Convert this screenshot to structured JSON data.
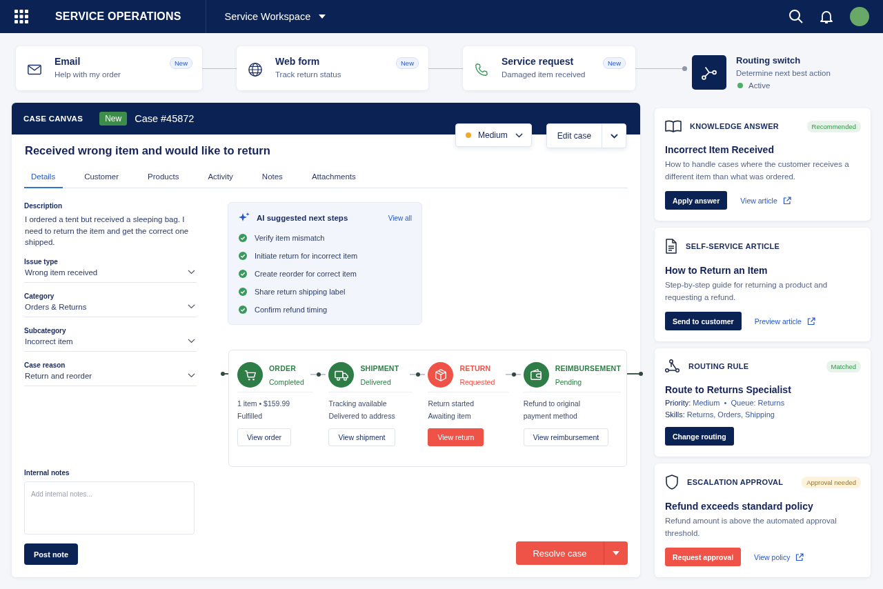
{
  "header": {
    "title": "SERVICE OPERATIONS",
    "workspace": "Service Workspace"
  },
  "channels": [
    {
      "title": "Email",
      "subtitle": "Help with my order",
      "badge": "New"
    },
    {
      "title": "Web form",
      "subtitle": "Track return status",
      "badge": "New"
    },
    {
      "title": "Service request",
      "subtitle": "Damaged item received",
      "badge": "New"
    }
  ],
  "routing_switch": {
    "title": "Routing switch",
    "subtitle": "Determine next best action",
    "status": "Active",
    "color": "#4caf6a"
  },
  "case": {
    "label": "CASE CANVAS",
    "badge": "New",
    "number": "Case #45872",
    "title": "Received wrong item and would like to return",
    "priority": {
      "value": "Medium",
      "color": "#f0a830"
    },
    "edit_button": "Edit case",
    "tabs": [
      {
        "label": "Details",
        "selected": true
      },
      {
        "label": "Customer",
        "selected": false
      },
      {
        "label": "Products",
        "selected": false
      },
      {
        "label": "Activity",
        "selected": false
      },
      {
        "label": "Notes",
        "selected": false
      },
      {
        "label": "Attachments",
        "selected": false
      }
    ],
    "description_label": "Description",
    "description": "I ordered a tent but received a sleeping bag. I need to return the item and get the correct one shipped.",
    "fields": [
      {
        "label": "Issue type",
        "value": "Wrong item received"
      },
      {
        "label": "Category",
        "value": "Orders & Returns"
      },
      {
        "label": "Subcategory",
        "value": "Incorrect item"
      },
      {
        "label": "Case reason",
        "value": "Return and reorder"
      }
    ],
    "notes_label": "Internal notes",
    "notes_placeholder": "Add internal notes...",
    "post_button": "Post note",
    "ai": {
      "title": "AI suggested next steps",
      "link": "View all",
      "steps": [
        {
          "text": "Verify item mismatch",
          "done": true
        },
        {
          "text": "Initiate return for incorrect item",
          "done": true
        },
        {
          "text": "Create reorder for correct item",
          "done": true
        },
        {
          "text": "Share return shipping label",
          "done": true
        },
        {
          "text": "Confirm refund timing",
          "done": true
        }
      ]
    },
    "stages": [
      {
        "title": "ORDER",
        "status": "Completed",
        "color": "#2e7d46",
        "details": [
          "1 item  •  $159.99",
          "Fulfilled"
        ],
        "button": "View order",
        "primary": false
      },
      {
        "title": "SHIPMENT",
        "status": "Delivered",
        "color": "#2e7d46",
        "details": [
          "Tracking available",
          "Delivered to address"
        ],
        "button": "View shipment",
        "primary": false
      },
      {
        "title": "RETURN",
        "status": "Requested",
        "color": "#ef5246",
        "details": [
          "Return started",
          "Awaiting item"
        ],
        "button": "View return",
        "primary": true
      },
      {
        "title": "REIMBURSEMENT",
        "status": "Pending",
        "color": "#2e7d46",
        "details": [
          "Refund to original",
          "payment method"
        ],
        "button": "View reimbursement",
        "primary": false
      }
    ],
    "resolve_button": "Resolve case"
  },
  "panels": [
    {
      "label": "KNOWLEDGE ANSWER",
      "badge": {
        "text": "Recommended",
        "color": "#e8f4eb"
      },
      "title": "Incorrect Item Received",
      "description": "How to handle cases where the customer receives a different item than what was ordered.",
      "action": {
        "text": "Apply answer",
        "kind": "primary"
      },
      "link": "View article"
    },
    {
      "label": "SELF-SERVICE ARTICLE",
      "title": "How to Return an Item",
      "description": "Step-by-step guide for returning a product and requesting a refund.",
      "action": {
        "text": "Send to customer",
        "kind": "primary"
      },
      "link": "Preview article"
    },
    {
      "label": "ROUTING RULE",
      "badge": {
        "text": "Matched",
        "color": "#e8f4eb"
      },
      "title": "Route to Returns Specialist",
      "meta": [
        {
          "label": "Priority:",
          "value": "Medium  •  Queue: Returns"
        },
        {
          "label": "Skills:",
          "value": "Returns, Orders, Shipping"
        }
      ],
      "action": {
        "text": "Change routing",
        "kind": "primary"
      }
    },
    {
      "label": "ESCALATION APPROVAL",
      "badge": {
        "text": "Approval needed",
        "color": "#fdf3dc"
      },
      "title": "Refund exceeds standard policy",
      "description": "Refund amount is above the automated approval threshold.",
      "action": {
        "text": "Request approval",
        "kind": "danger"
      },
      "link": "View policy"
    }
  ]
}
